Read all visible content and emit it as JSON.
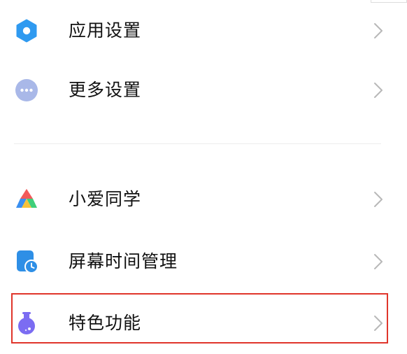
{
  "settings": {
    "items": [
      {
        "label": "应用设置",
        "icon": "gear-icon",
        "color": "#2f9af0"
      },
      {
        "label": "更多设置",
        "icon": "more-icon",
        "color": "#a9b8e8"
      },
      {
        "label": "小爱同学",
        "icon": "xiaoai-icon",
        "color": "#f25a5a"
      },
      {
        "label": "屏幕时间管理",
        "icon": "screen-time-icon",
        "color": "#2e8fe6"
      },
      {
        "label": "特色功能",
        "icon": "flask-icon",
        "color": "#7b6cf2"
      }
    ],
    "highlight_color": "#e0352b"
  }
}
